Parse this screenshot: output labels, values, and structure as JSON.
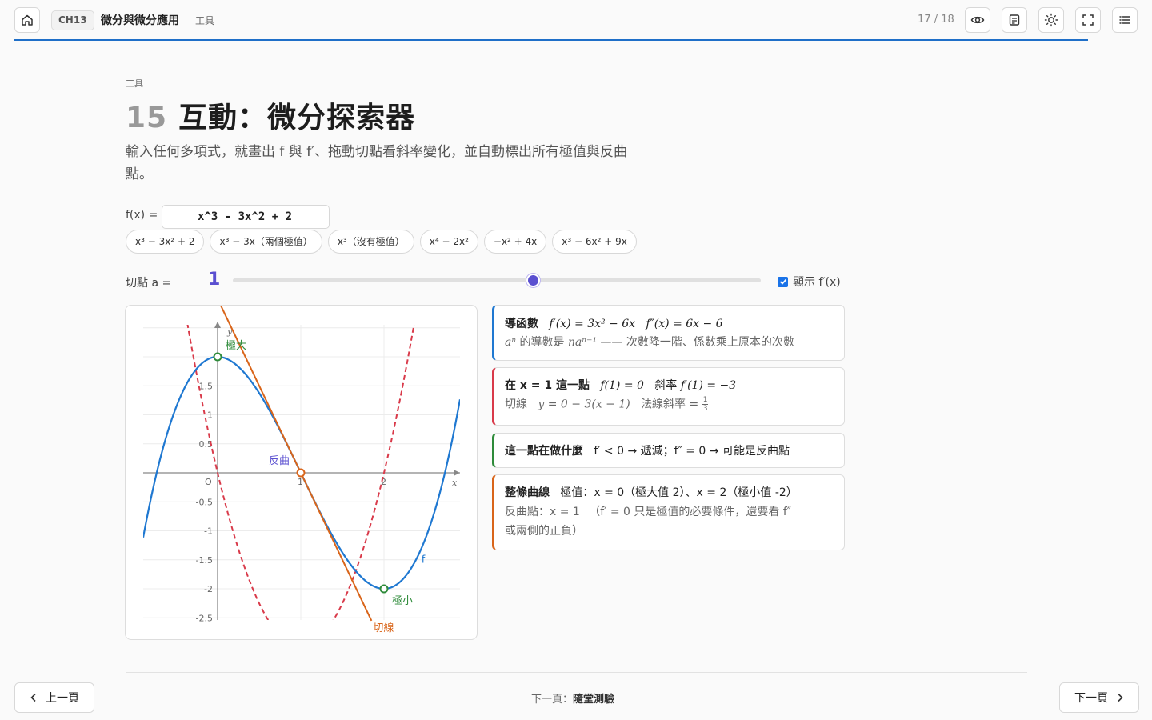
{
  "header": {
    "chapter": "CH13",
    "title": "微分與微分應用",
    "subtitle": "工具",
    "page_count": "17 / 18",
    "icons": [
      "home-icon",
      "eye-icon",
      "notes-icon",
      "sun-icon",
      "fullscreen-icon",
      "list-icon"
    ],
    "progress": 0.944
  },
  "page": {
    "section_tag": "工具",
    "title_num": "15",
    "title": "互動：微分探索器",
    "description": "輸入任何多項式，就畫出 f 與 f′、拖動切點看斜率變化，並自動標出所有極值與反曲點。"
  },
  "controls": {
    "fx_label": "f(x) =",
    "fx_value": "x^3 - 3x^2 + 2",
    "presets": [
      "x³ − 3x² + 2",
      "x³ − 3x（兩個極值）",
      "x³（沒有極值）",
      "x⁴ − 2x²",
      "−x² + 4x",
      "x³ − 6x² + 9x"
    ],
    "a_label": "切點 a =",
    "a_value": "1",
    "slider": {
      "min": -2,
      "max": 4,
      "value": 1
    },
    "show_derivative_label": "顯示 f′(x)",
    "show_derivative": true
  },
  "graph": {
    "axis_x": "x",
    "axis_y": "y",
    "x_ticks": [
      "O",
      "1",
      "2"
    ],
    "y_ticks": [
      "1.5",
      "1",
      "0.5",
      "-0.5",
      "-1",
      "-1.5",
      "-2",
      "-2.5"
    ],
    "labels": {
      "max": "極大",
      "min": "極小",
      "inflection": "反曲",
      "tangent": "切線",
      "f": "f"
    },
    "colors": {
      "f": "#1f78d1",
      "derivative": "#d93a4a",
      "tangent": "#d9651a",
      "extrema": "#2e8b3a",
      "inflection": "#5a4fd0"
    }
  },
  "chart_data": {
    "type": "line",
    "xlim": [
      -0.9,
      2.9
    ],
    "ylim": [
      -2.5,
      2.5
    ],
    "grid": true,
    "series": [
      {
        "name": "f",
        "expr": "x^3 - 3x^2 + 2"
      },
      {
        "name": "f′",
        "expr": "3x^2 - 6x",
        "style": "dashed"
      },
      {
        "name": "切線",
        "expr": "-3x + 3"
      }
    ],
    "points": [
      {
        "label": "極大",
        "x": 0,
        "y": 2
      },
      {
        "label": "極小",
        "x": 2,
        "y": -2
      },
      {
        "label": "反曲",
        "x": 1,
        "y": 0
      }
    ]
  },
  "cards": {
    "c1_title": "導函數",
    "c1_fp": "f′(x) = 3x² − 6x",
    "c1_fpp": "f″(x) = 6x − 6",
    "c1_note_a": "aⁿ",
    "c1_note_b": " 的導數是 ",
    "c1_note_c": "naⁿ⁻¹",
    "c1_note_d": " —— 次數降一階、係數乘上原本的次數",
    "c2_title": "在 x = 1 這一點",
    "c2_f": "f(1) = 0",
    "c2_slope_label": "斜率 ",
    "c2_slope": "f′(1) = −3",
    "c2_tan_label": "切線",
    "c2_tan": "y = 0 − 3(x − 1)",
    "c2_normal_label": "法線斜率 =",
    "c2_normal_n": "1",
    "c2_normal_d": "3",
    "c3_title": "這一點在做什麼",
    "c3_text": "f′ < 0 → 遞減；f″ = 0 → 可能是反曲點",
    "c4_title": "整條曲線",
    "c4_extrema": "極值：x = 0（極大值 2）、x = 2（極小值 -2）",
    "c4_infl": "反曲點：x = 1 　（f′ = 0 只是極值的必要條件，還要看 f″",
    "c4_infl2": "或兩側的正負）"
  },
  "footer": {
    "prev_label": "上一頁",
    "next_label": "下一頁",
    "next_hint_prefix": "下一頁：",
    "next_hint_title": "隨堂測驗"
  }
}
